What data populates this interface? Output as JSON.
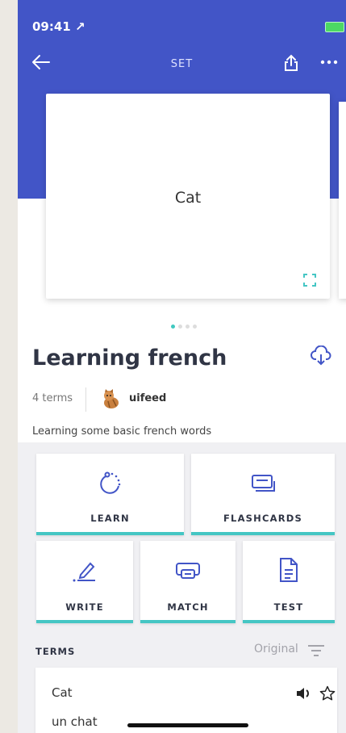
{
  "status_bar": {
    "time": "09:41 ↗"
  },
  "nav": {
    "title": "SET"
  },
  "flashcard": {
    "word": "Cat"
  },
  "set": {
    "title": "Learning french",
    "terms_count": "4 terms",
    "username": "uifeed",
    "description": "Learning some basic french words"
  },
  "modes": {
    "learn": "LEARN",
    "flashcards": "FLASHCARDS",
    "write": "WRITE",
    "match": "MATCH",
    "test": "TEST"
  },
  "terms_section": {
    "header": "TERMS",
    "sort": "Original"
  },
  "terms": [
    {
      "term": "Cat",
      "definition": "un chat"
    }
  ],
  "colors": {
    "header": "#4255c7",
    "accent": "#45c6c4"
  }
}
